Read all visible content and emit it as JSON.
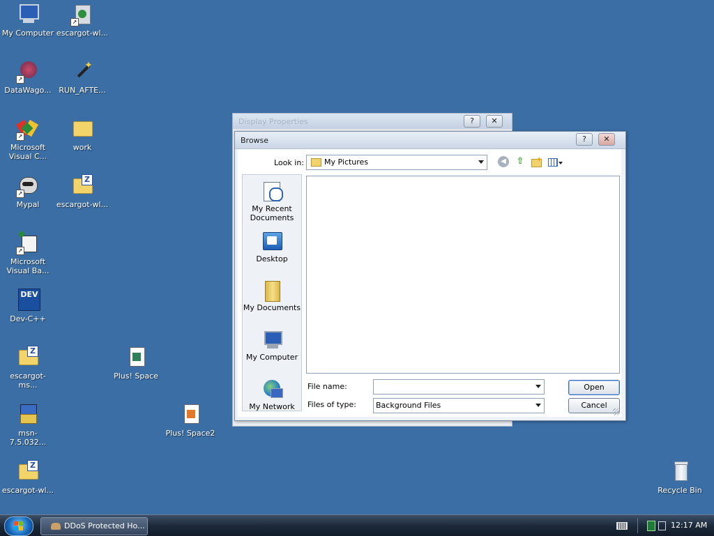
{
  "desktop": {
    "icons": [
      {
        "label": "My Computer"
      },
      {
        "label": "escargot-wl..."
      },
      {
        "label": "DataWago..."
      },
      {
        "label": "RUN_AFTE..."
      },
      {
        "label": "Microsoft Visual C..."
      },
      {
        "label": "work"
      },
      {
        "label": "Mypal"
      },
      {
        "label": "escargot-wl..."
      },
      {
        "label": "Microsoft Visual Ba..."
      },
      {
        "label": "Dev-C++"
      },
      {
        "label": "escargot-ms..."
      },
      {
        "label": "Plus! Space"
      },
      {
        "label": "msn-7.5.032..."
      },
      {
        "label": "Plus! Space2"
      },
      {
        "label": "escargot-wl..."
      },
      {
        "label": "Recycle Bin"
      }
    ],
    "dev_icon_text": "DEV"
  },
  "display_properties": {
    "title": "Display Properties",
    "help_label": "?",
    "close_label": "✕"
  },
  "browse": {
    "title": "Browse",
    "help_label": "?",
    "close_label": "✕",
    "look_in_label": "Look in:",
    "look_in_value": "My Pictures",
    "places": [
      {
        "label": "My Recent Documents"
      },
      {
        "label": "Desktop"
      },
      {
        "label": "My Documents"
      },
      {
        "label": "My Computer"
      },
      {
        "label": "My Network"
      }
    ],
    "file_name_label": "File name:",
    "file_name_value": "",
    "files_of_type_label": "Files of type:",
    "files_of_type_value": "Background Files",
    "open_label": "Open",
    "cancel_label": "Cancel"
  },
  "taskbar": {
    "task_label": "DDoS Protected Ho...",
    "clock": "12:17 AM"
  }
}
